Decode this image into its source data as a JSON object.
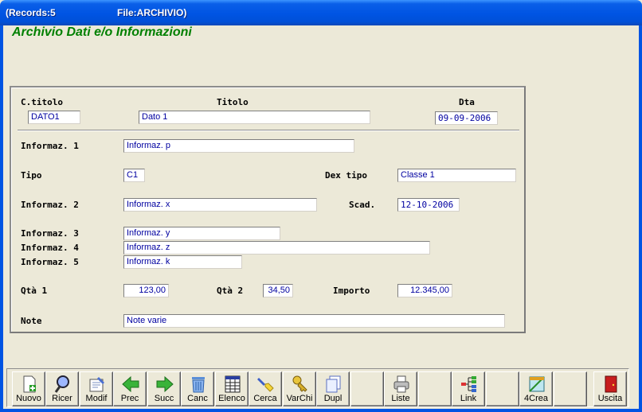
{
  "window": {
    "records": "(Records:5",
    "file": "File:ARCHIVIO)"
  },
  "app_title": "Archivio Dati e/o Informazioni",
  "form": {
    "ctitolo_label": "C.titolo",
    "ctitolo_value": "DATO1",
    "titolo_label": "Titolo",
    "titolo_value": "Dato 1",
    "dta_label": "Dta",
    "dta_value": "09-09-2006",
    "info1_label": "Informaz. 1",
    "info1_value": "Informaz. p",
    "tipo_label": "Tipo",
    "tipo_value": "C1",
    "dextipo_label": "Dex tipo",
    "dextipo_value": "Classe 1",
    "info2_label": "Informaz. 2",
    "info2_value": "Informaz. x",
    "scad_label": "Scad.",
    "scad_value": "12-10-2006",
    "info3_label": "Informaz. 3",
    "info3_value": "Informaz. y",
    "info4_label": "Informaz. 4",
    "info4_value": "Informaz. z",
    "info5_label": "Informaz. 5",
    "info5_value": "Informaz. k",
    "qta1_label": "Qtà 1",
    "qta1_value": "123,00",
    "qta2_label": "Qtà 2",
    "qta2_value": "34,50",
    "importo_label": "Importo",
    "importo_value": "12.345,00",
    "note_label": "Note",
    "note_value": "Note varie"
  },
  "toolbar": {
    "nuovo": "Nuovo",
    "ricer": "Ricer",
    "modif": "Modif",
    "prec": "Prec",
    "succ": "Succ",
    "canc": "Canc",
    "elenco": "Elenco",
    "cerca": "Cerca",
    "varchi": "VarChi",
    "dupl": "Dupl",
    "liste": "Liste",
    "link": "Link",
    "crea4": "4Crea",
    "uscita": "Uscita"
  },
  "colors": {
    "title_green": "#008000",
    "field_text": "#0000a0",
    "titlebar_blue": "#0054E3"
  }
}
